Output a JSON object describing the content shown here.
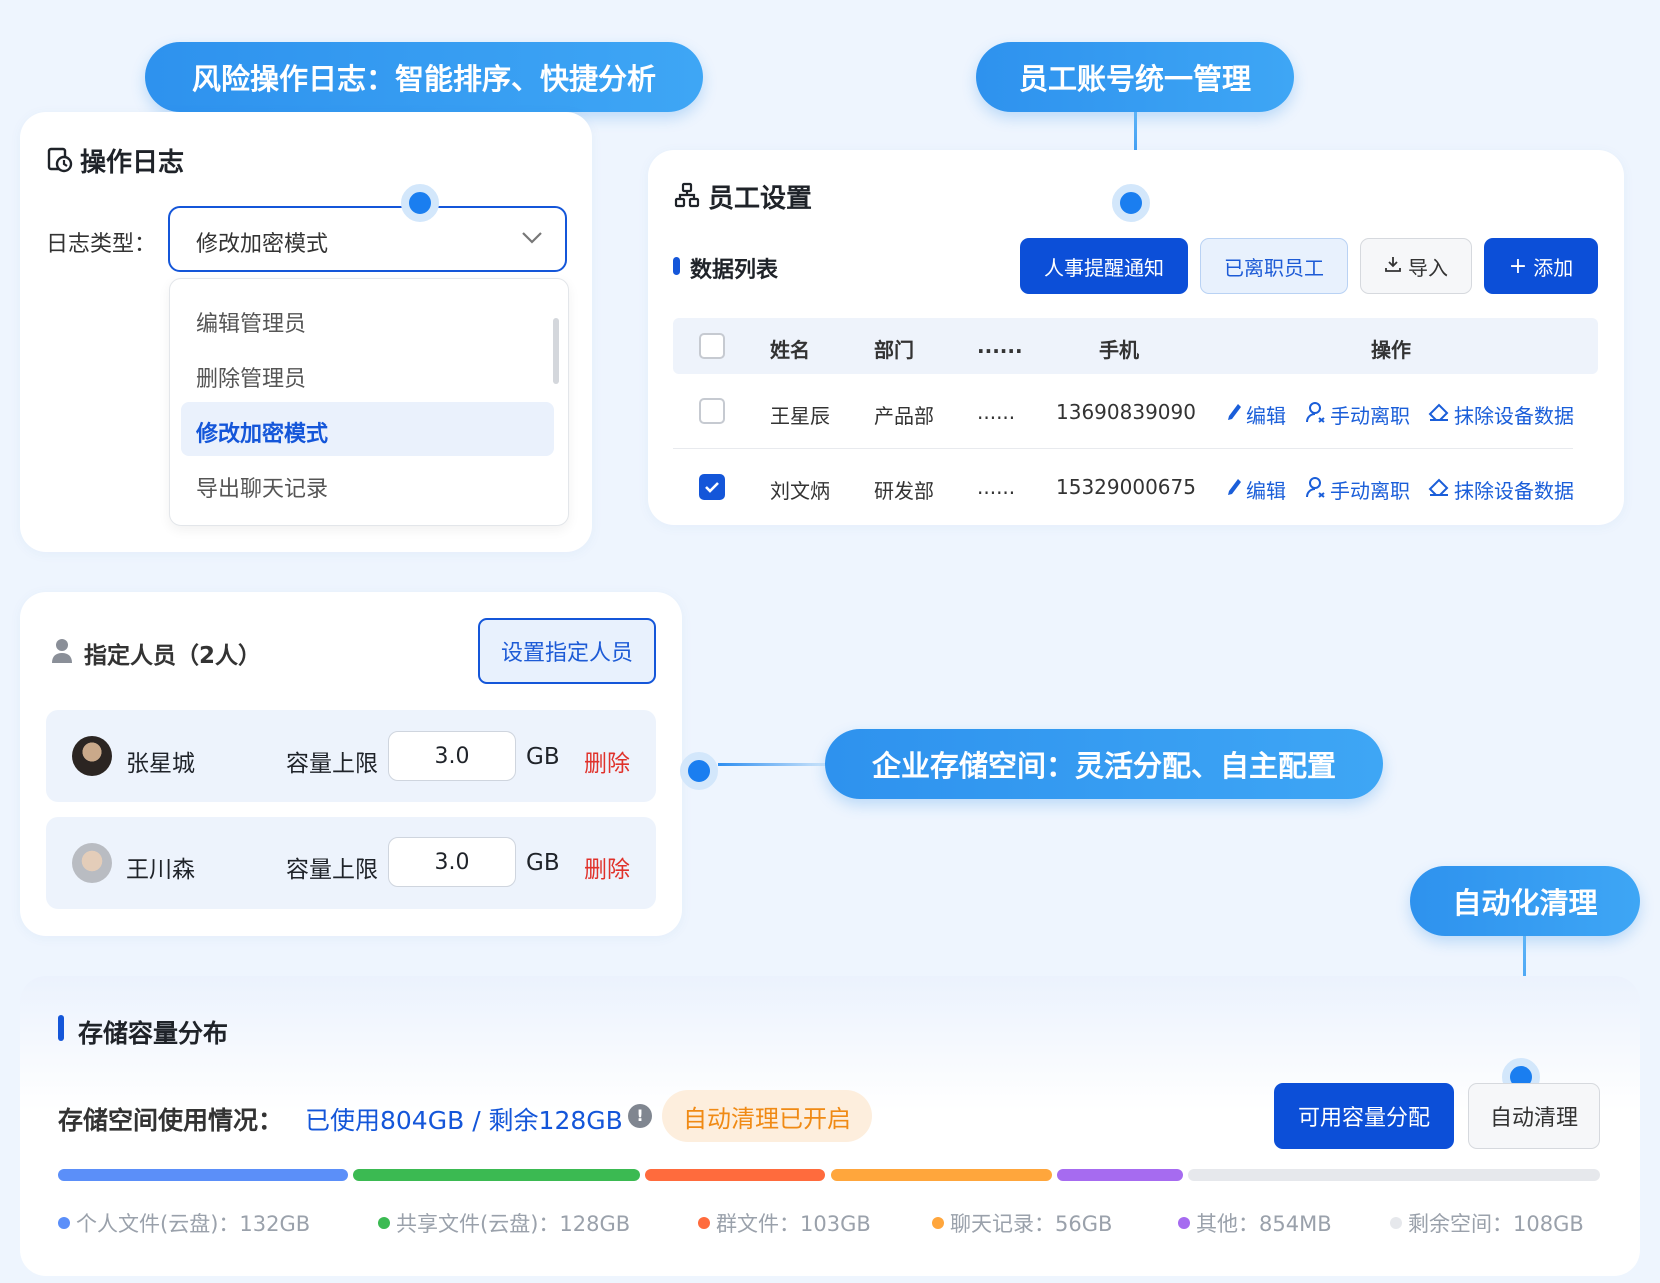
{
  "callouts": {
    "log": "风险操作日志：智能排序、快捷分析",
    "staff": "员工账号统一管理",
    "storage": "企业存储空间：灵活分配、自主配置",
    "cleanup": "自动化清理"
  },
  "log_panel": {
    "title": "操作日志",
    "type_label": "日志类型：",
    "selected": "修改加密模式",
    "options": [
      "编辑管理员",
      "删除管理员",
      "修改加密模式",
      "导出聊天记录"
    ]
  },
  "staff_panel": {
    "title": "员工设置",
    "list_title": "数据列表",
    "buttons": {
      "notify": "人事提醒通知",
      "left": "已离职员工",
      "import": "导入",
      "add": "添加"
    },
    "columns": [
      "姓名",
      "部门",
      "......",
      "手机",
      "操作"
    ],
    "rows": [
      {
        "name": "王星辰",
        "dept": "产品部",
        "more": "......",
        "phone": "13690839090",
        "checked": false
      },
      {
        "name": "刘文炳",
        "dept": "研发部",
        "more": "......",
        "phone": "15329000675",
        "checked": true
      }
    ],
    "actions": {
      "edit": "编辑",
      "resign": "手动离职",
      "wipe": "抹除设备数据"
    }
  },
  "assign_panel": {
    "title": "指定人员（2人）",
    "set_button": "设置指定人员",
    "cap_label": "容量上限",
    "unit": "GB",
    "delete": "删除",
    "people": [
      {
        "name": "张星城",
        "cap": "3.0"
      },
      {
        "name": "王川森",
        "cap": "3.0"
      }
    ]
  },
  "storage_panel": {
    "title": "存储容量分布",
    "usage_label": "存储空间使用情况：",
    "usage_value": "已使用804GB / 剩余128GB",
    "auto_badge": "自动清理已开启",
    "btn_alloc": "可用容量分配",
    "btn_clean": "自动清理",
    "legend": [
      {
        "label": "个人文件(云盘)：132GB",
        "color": "#5b8ff9"
      },
      {
        "label": "共享文件(云盘)：128GB",
        "color": "#3bba52"
      },
      {
        "label": "群文件：103GB",
        "color": "#ff6b3d"
      },
      {
        "label": "聊天记录：56GB",
        "color": "#ffa63c"
      },
      {
        "label": "其他：854MB",
        "color": "#a66bf0"
      },
      {
        "label": "剩余空间：108GB",
        "color": "#e6e8ec"
      }
    ]
  }
}
